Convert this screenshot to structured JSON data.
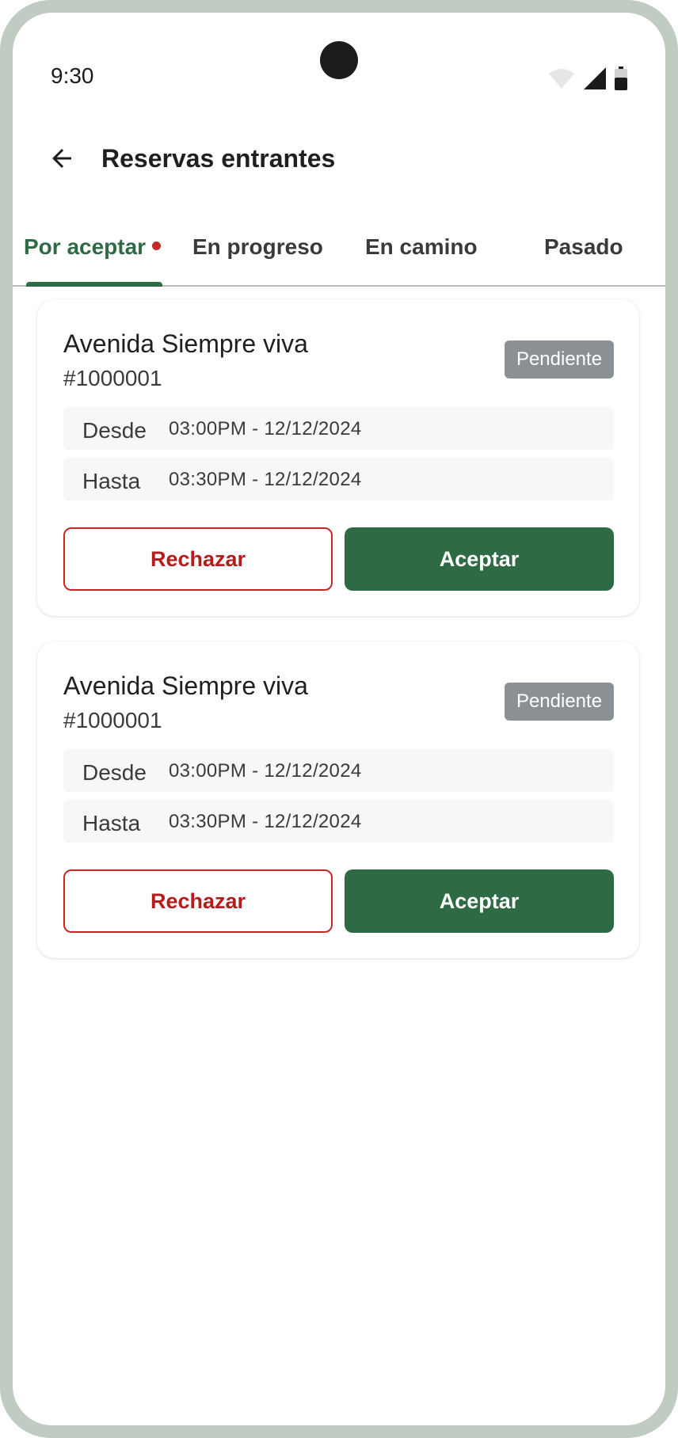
{
  "status_bar": {
    "time": "9:30"
  },
  "app_bar": {
    "title": "Reservas entrantes"
  },
  "tabs": [
    {
      "label": "Por aceptar",
      "active": true,
      "has_dot": true
    },
    {
      "label": "En progreso",
      "active": false
    },
    {
      "label": "En camino",
      "active": false
    },
    {
      "label": "Pasado",
      "active": false
    }
  ],
  "bookings": [
    {
      "address": "Avenida Siempre viva",
      "id": "#1000001",
      "status": "Pendiente",
      "from_label": "Desde",
      "from_value": "03:00PM - 12/12/2024",
      "to_label": "Hasta",
      "to_value": "03:30PM - 12/12/2024",
      "reject_label": "Rechazar",
      "accept_label": "Aceptar"
    },
    {
      "address": "Avenida Siempre viva",
      "id": "#1000001",
      "status": "Pendiente",
      "from_label": "Desde",
      "from_value": "03:00PM - 12/12/2024",
      "to_label": "Hasta",
      "to_value": "03:30PM - 12/12/2024",
      "reject_label": "Rechazar",
      "accept_label": "Aceptar"
    }
  ],
  "colors": {
    "primary": "#2e6b45",
    "danger": "#c62828",
    "badge": "#8a9094",
    "frame": "#c0cbc2"
  }
}
